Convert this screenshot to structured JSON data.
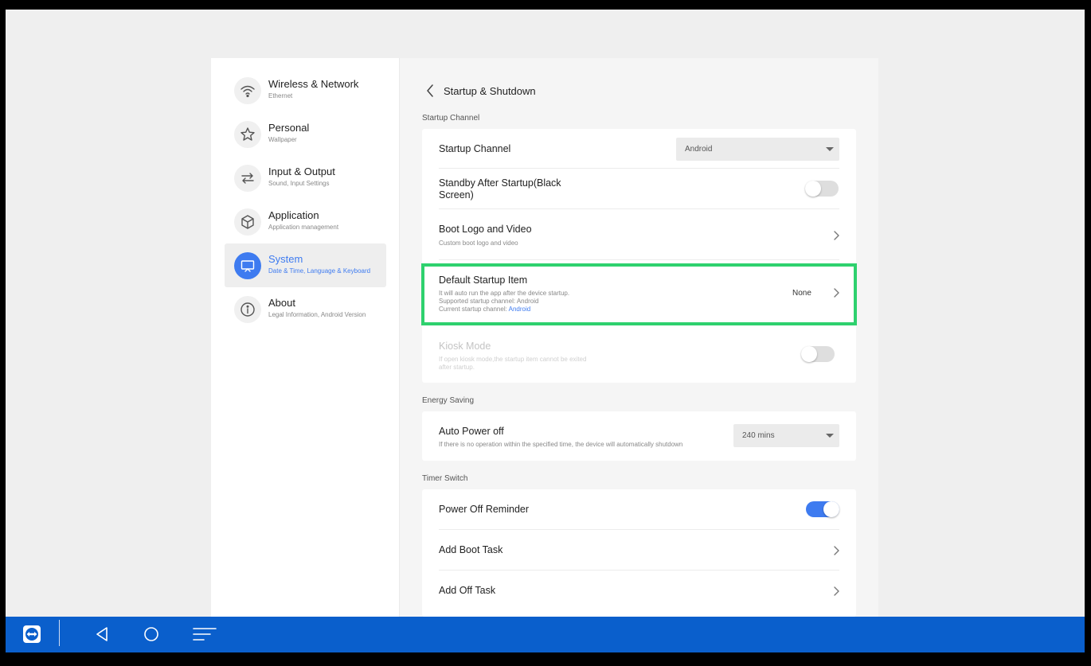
{
  "sidebar": {
    "items": [
      {
        "title": "Wireless & Network",
        "subtitle": "Ethernet",
        "icon": "wifi-icon"
      },
      {
        "title": "Personal",
        "subtitle": "Wallpaper",
        "icon": "star-icon"
      },
      {
        "title": "Input & Output",
        "subtitle": "Sound, Input Settings",
        "icon": "swap-arrows-icon"
      },
      {
        "title": "Application",
        "subtitle": "Application management",
        "icon": "cube-icon"
      },
      {
        "title": "System",
        "subtitle": "Date & Time, Language & Keyboard",
        "icon": "monitor-icon",
        "active": true
      },
      {
        "title": "About",
        "subtitle": "Legal Information, Android Version",
        "icon": "info-icon"
      }
    ]
  },
  "header": {
    "title": "Startup & Shutdown"
  },
  "startup": {
    "section_label": "Startup Channel",
    "channel": {
      "title": "Startup Channel",
      "value": "Android"
    },
    "standby": {
      "title_line1": "Standby After Startup(Black",
      "title_line2": "Screen)",
      "enabled": false
    },
    "boot_logo": {
      "title": "Boot Logo and Video",
      "subtitle": "Custom boot logo and video"
    },
    "default_item": {
      "title": "Default Startup Item",
      "sub_line1": "It will auto run the app after the device startup.",
      "sub_line2": "Supported startup channel: Android",
      "sub_line3_prefix": "Current startup channel: ",
      "sub_line3_value": "Android",
      "value": "None"
    },
    "kiosk": {
      "title": "Kiosk Mode",
      "sub_line1": "If open kiosk mode,the startup item cannot be exited",
      "sub_line2": "after startup.",
      "enabled": false
    }
  },
  "energy": {
    "section_label": "Energy Saving",
    "auto_power": {
      "title": "Auto Power off",
      "subtitle": "If there is no operation within the specified time, the device will automatically shutdown",
      "value": "240 mins"
    }
  },
  "timer": {
    "section_label": "Timer Switch",
    "reminder": {
      "title": "Power Off Reminder",
      "enabled": true
    },
    "boot_task": {
      "title": "Add Boot Task"
    },
    "off_task": {
      "title": "Add Off Task"
    }
  },
  "colors": {
    "accent": "#3e7bf0",
    "highlight": "#2ed16e",
    "taskbar": "#0a5fcc"
  }
}
